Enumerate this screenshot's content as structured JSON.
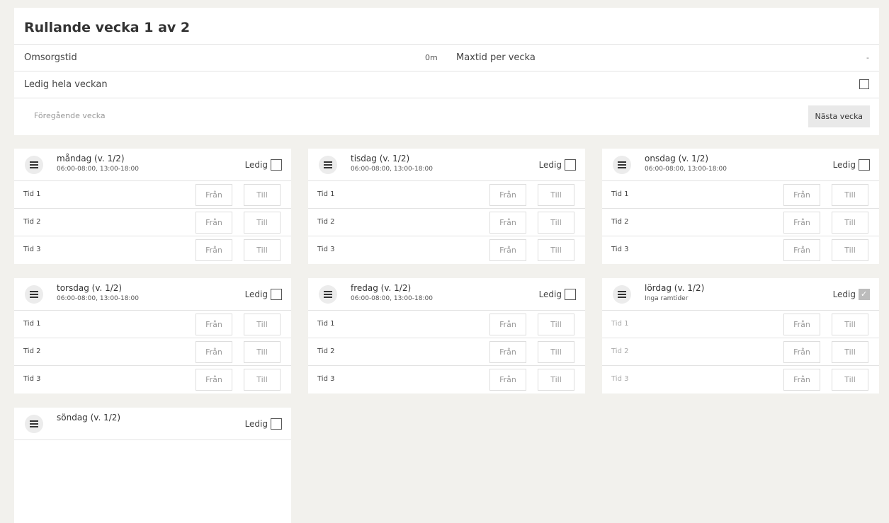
{
  "week": {
    "title": "Rullande vecka 1 av 2",
    "omsorgstid_label": "Omsorgstid",
    "omsorgstid_value": "0m",
    "maxtid_label": "Maxtid per vecka",
    "maxtid_value": "-",
    "ledig_hela_label": "Ledig hela veckan",
    "prev_label": "Föregående vecka",
    "next_label": "Nästa vecka"
  },
  "ledig_label": "Ledig",
  "from_placeholder": "Från",
  "to_placeholder": "Till",
  "days": [
    {
      "name": "måndag (v. 1/2)",
      "times": "06:00-08:00, 13:00-18:00",
      "ledig": false,
      "tid": [
        "Tid 1",
        "Tid 2",
        "Tid 3"
      ]
    },
    {
      "name": "tisdag (v. 1/2)",
      "times": "06:00-08:00, 13:00-18:00",
      "ledig": false,
      "tid": [
        "Tid 1",
        "Tid 2",
        "Tid 3"
      ]
    },
    {
      "name": "onsdag (v. 1/2)",
      "times": "06:00-08:00, 13:00-18:00",
      "ledig": false,
      "tid": [
        "Tid 1",
        "Tid 2",
        "Tid 3"
      ]
    },
    {
      "name": "torsdag (v. 1/2)",
      "times": "06:00-08:00, 13:00-18:00",
      "ledig": false,
      "tid": [
        "Tid 1",
        "Tid 2",
        "Tid 3"
      ]
    },
    {
      "name": "fredag (v. 1/2)",
      "times": "06:00-08:00, 13:00-18:00",
      "ledig": false,
      "tid": [
        "Tid 1",
        "Tid 2",
        "Tid 3"
      ]
    },
    {
      "name": "lördag (v. 1/2)",
      "times": "Inga ramtider",
      "ledig": true,
      "tid": [
        "Tid 1",
        "Tid 2",
        "Tid 3"
      ]
    },
    {
      "name": "söndag (v. 1/2)",
      "times": "",
      "ledig": false,
      "tid": []
    }
  ]
}
